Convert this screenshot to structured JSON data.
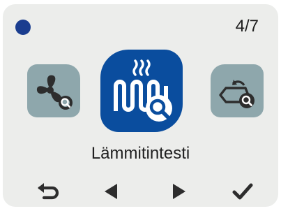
{
  "status": {
    "indicator_color": "#1a3d8f"
  },
  "pager": {
    "text": "4/7"
  },
  "menu": {
    "current_label": "Lämmitintesti",
    "current_icon": "heater-test-icon",
    "prev_icon": "fan-test-icon",
    "next_icon": "valve-test-icon",
    "accent_color": "#0a4d9e",
    "side_color": "#8ea7ac"
  },
  "navigation": {
    "back_icon": "back-arrow-icon",
    "left_icon": "triangle-left-icon",
    "right_icon": "triangle-right-icon",
    "confirm_icon": "checkmark-icon"
  }
}
